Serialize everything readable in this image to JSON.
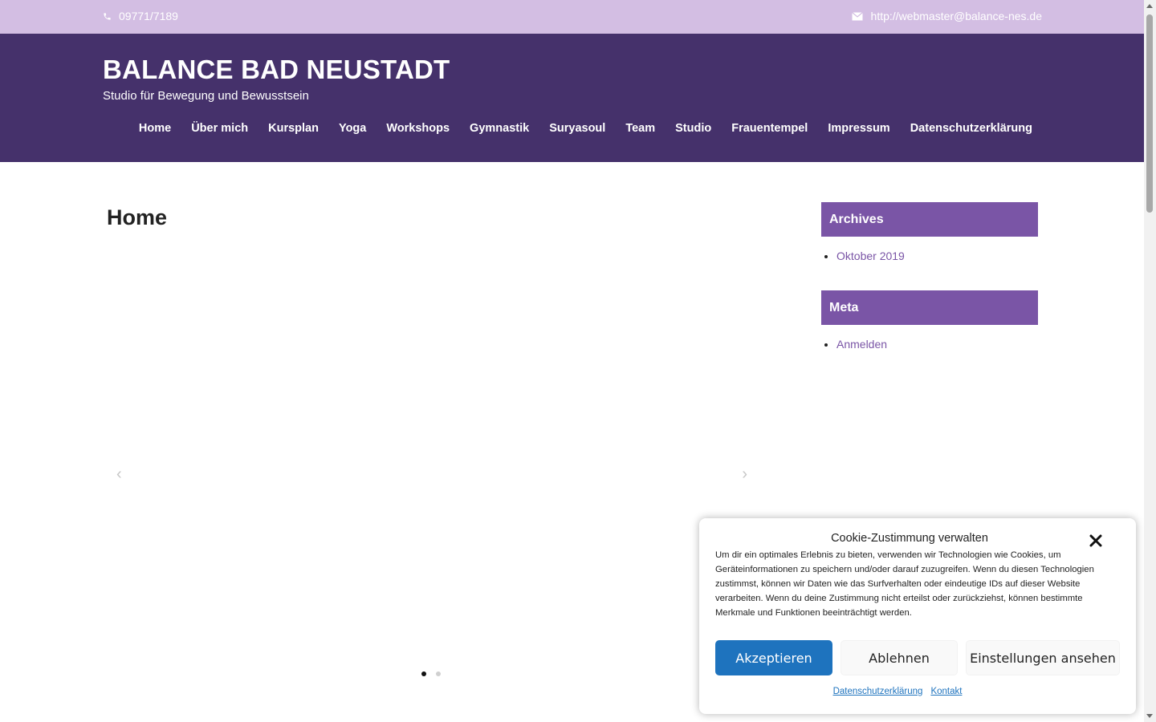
{
  "topbar": {
    "phone": "09771/7189",
    "email": "http://webmaster@balance-nes.de",
    "icons": [
      "phone-icon",
      "mail-icon"
    ]
  },
  "header": {
    "title": "BALANCE BAD NEUSTADT",
    "tagline": "Studio für Bewegung und Bewusstsein",
    "nav": [
      "Home",
      "Über mich",
      "Kursplan",
      "Yoga",
      "Workshops",
      "Gymnastik",
      "Suryasoul",
      "Team",
      "Studio",
      "Frauentempel",
      "Impressum",
      "Datenschutzerklärung"
    ]
  },
  "main": {
    "page_title": "Home",
    "slider": {
      "prev_label": "‹",
      "next_label": "›",
      "dots": 2,
      "active_dot": 1
    }
  },
  "sidebar": {
    "archives": {
      "title": "Archives",
      "items": [
        "Oktober 2019"
      ]
    },
    "meta": {
      "title": "Meta",
      "items": [
        "Anmelden"
      ]
    }
  },
  "cookie": {
    "title": "Cookie-Zustimmung verwalten",
    "body": "Um dir ein optimales Erlebnis zu bieten, verwenden wir Technologien wie Cookies, um Geräteinformationen zu speichern und/oder darauf zuzugreifen. Wenn du diesen Technologien zustimmst, können wir Daten wie das Surfverhalten oder eindeutige IDs auf dieser Website verarbeiten. Wenn du deine Zustimmung nicht erteilst oder zurückziehst, können bestimmte Merkmale und Funktionen beeinträchtigt werden.",
    "accept": "Akzeptieren",
    "deny": "Ablehnen",
    "settings": "Einstellungen ansehen",
    "links": [
      "Datenschutzerklärung",
      "Kontakt"
    ]
  },
  "colors": {
    "topbar": "#d3bee3",
    "header": "#45316b",
    "widget": "#7a55a6",
    "accept": "#1e73be"
  }
}
